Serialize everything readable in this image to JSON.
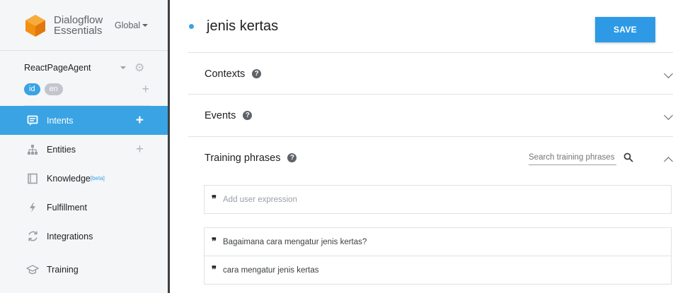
{
  "brand": {
    "name": "Dialogflow Essentials",
    "region": "Global"
  },
  "agent": {
    "name": "ReactPageAgent",
    "languages": [
      "id",
      "en"
    ]
  },
  "nav": [
    {
      "label": "Intents",
      "icon": "chat-icon",
      "active": true
    },
    {
      "label": "Entities",
      "icon": "hierarchy-icon"
    },
    {
      "label": "Knowledge",
      "badge": "[beta]",
      "icon": "book-icon"
    },
    {
      "label": "Fulfillment",
      "icon": "bolt-icon"
    },
    {
      "label": "Integrations",
      "icon": "refresh-icon"
    },
    {
      "label": "Training",
      "icon": "graduation-cap-icon"
    }
  ],
  "intent": {
    "title": "jenis kertas"
  },
  "toolbar": {
    "save_label": "SAVE"
  },
  "sections": {
    "contexts": "Contexts",
    "events": "Events",
    "training": "Training phrases"
  },
  "search": {
    "placeholder": "Search training phrases"
  },
  "expression": {
    "placeholder": "Add user expression"
  },
  "phrases": [
    "Bagaimana cara mengatur jenis kertas?",
    "cara mengatur jenis kertas"
  ],
  "colors": {
    "accent": "#3aa3e3",
    "save": "#2e9ae6",
    "logo": "#f29111"
  }
}
